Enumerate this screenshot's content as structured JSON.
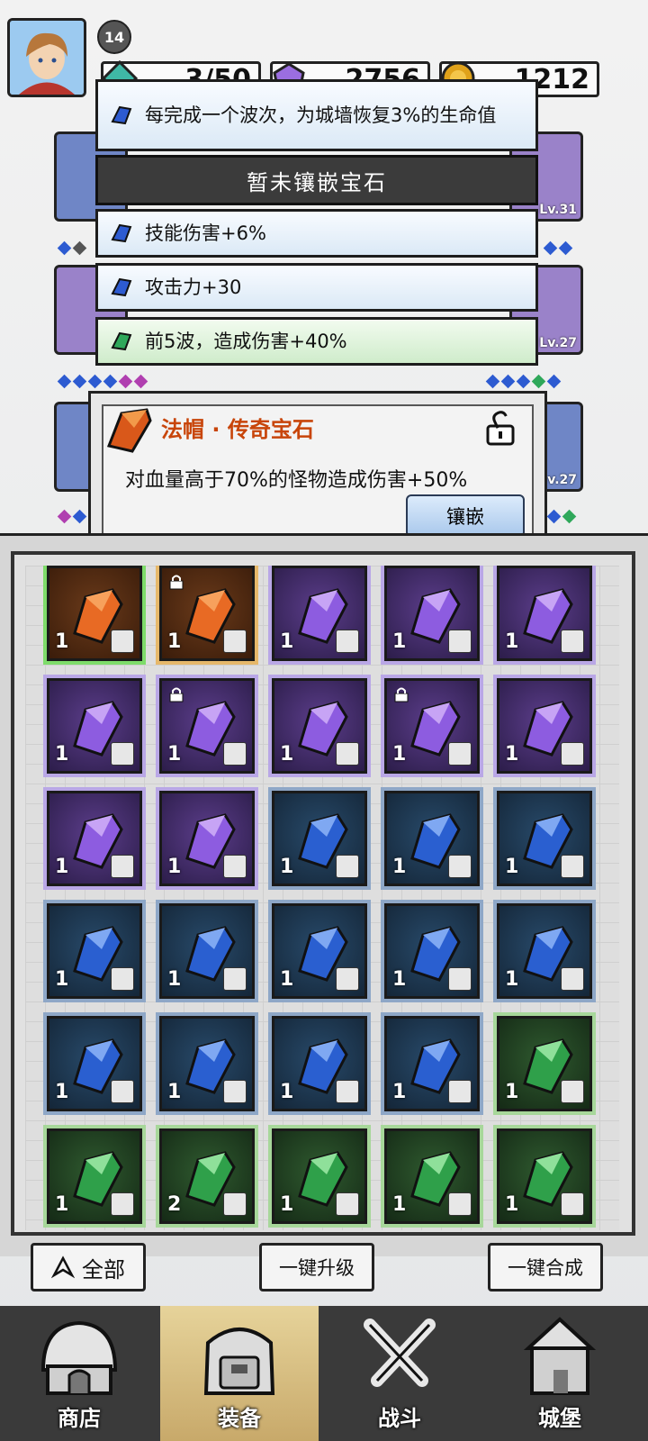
{
  "player": {
    "level": "14"
  },
  "resources": [
    {
      "name": "energy",
      "value": "3/50",
      "icon": "teal-gem-icon",
      "color": "#3fb8a6"
    },
    {
      "name": "gems",
      "value": "2756",
      "icon": "purple-gem-icon",
      "color": "#9b6ee0"
    },
    {
      "name": "coins",
      "value": "1212",
      "icon": "gold-coin-icon",
      "color": "#e0a21a"
    }
  ],
  "equipment_slots": [
    {
      "side": "left",
      "level": ""
    },
    {
      "side": "right",
      "level": "Lv.31"
    },
    {
      "side": "left",
      "level": ""
    },
    {
      "side": "right",
      "level": "Lv.27"
    },
    {
      "side": "left",
      "level": ""
    },
    {
      "side": "right",
      "level": "v.27"
    }
  ],
  "skills": {
    "first": "每完成一个波次，为城墙恢复3%的生命值",
    "no_gem": "暂未镶嵌宝石",
    "list": [
      {
        "text": "技能伤害+6%",
        "gem": "blue"
      },
      {
        "text": "攻击力+30",
        "gem": "blue"
      },
      {
        "text": "前5波，造成伤害+40%",
        "gem": "green"
      }
    ]
  },
  "gem_popup": {
    "title": "法帽 · 传奇宝石",
    "description": "对血量高于70%的怪物造成伤害+50%",
    "button": "镶嵌"
  },
  "inventory": [
    {
      "color": "orange",
      "count": "1",
      "locked": false,
      "selected": true,
      "slot": "ring"
    },
    {
      "color": "orange",
      "count": "1",
      "locked": true,
      "slot": "boot"
    },
    {
      "color": "purple",
      "count": "1",
      "locked": false,
      "slot": "armor"
    },
    {
      "color": "purple",
      "count": "1",
      "locked": false,
      "slot": "armor"
    },
    {
      "color": "purple",
      "count": "1",
      "locked": false,
      "slot": "armor"
    },
    {
      "color": "purple",
      "count": "1",
      "locked": false,
      "slot": "wand"
    },
    {
      "color": "purple",
      "count": "1",
      "locked": true,
      "slot": "wand"
    },
    {
      "color": "purple",
      "count": "1",
      "locked": false,
      "slot": "hat"
    },
    {
      "color": "purple",
      "count": "1",
      "locked": true,
      "slot": "hat"
    },
    {
      "color": "purple",
      "count": "1",
      "locked": false,
      "slot": "hat"
    },
    {
      "color": "purple",
      "count": "1",
      "locked": false,
      "slot": "necklace"
    },
    {
      "color": "purple",
      "count": "1",
      "locked": false,
      "slot": "necklace"
    },
    {
      "color": "blue",
      "count": "1",
      "locked": false,
      "slot": "ring"
    },
    {
      "color": "blue",
      "count": "1",
      "locked": false,
      "slot": "ring"
    },
    {
      "color": "blue",
      "count": "1",
      "locked": false,
      "slot": "ring"
    },
    {
      "color": "blue",
      "count": "1",
      "locked": false,
      "slot": "armor"
    },
    {
      "color": "blue",
      "count": "1",
      "locked": false,
      "slot": "wand"
    },
    {
      "color": "blue",
      "count": "1",
      "locked": false,
      "slot": "wand"
    },
    {
      "color": "blue",
      "count": "1",
      "locked": false,
      "slot": "wand"
    },
    {
      "color": "blue",
      "count": "1",
      "locked": false,
      "slot": "hat"
    },
    {
      "color": "blue",
      "count": "1",
      "locked": false,
      "slot": "hat"
    },
    {
      "color": "blue",
      "count": "1",
      "locked": false,
      "slot": "hat"
    },
    {
      "color": "blue",
      "count": "1",
      "locked": false,
      "slot": "hat"
    },
    {
      "color": "blue",
      "count": "1",
      "locked": false,
      "slot": "necklace"
    },
    {
      "color": "green",
      "count": "1",
      "locked": false,
      "slot": "boot"
    },
    {
      "color": "green",
      "count": "1",
      "locked": false,
      "slot": "armor"
    },
    {
      "color": "green",
      "count": "2",
      "locked": false,
      "slot": "boot"
    },
    {
      "color": "green",
      "count": "1",
      "locked": false,
      "slot": "hat"
    },
    {
      "color": "green",
      "count": "1",
      "locked": false,
      "slot": "hat"
    },
    {
      "color": "green",
      "count": "1",
      "locked": false,
      "slot": "necklace"
    }
  ],
  "actions": {
    "filter": "全部",
    "upgrade_all": "一键升级",
    "merge_all": "一键合成"
  },
  "nav": [
    {
      "label": "商店",
      "icon": "shop-hut-icon"
    },
    {
      "label": "装备",
      "icon": "backpack-icon",
      "active": true
    },
    {
      "label": "战斗",
      "icon": "crossed-swords-icon"
    },
    {
      "label": "城堡",
      "icon": "castle-icon"
    }
  ]
}
